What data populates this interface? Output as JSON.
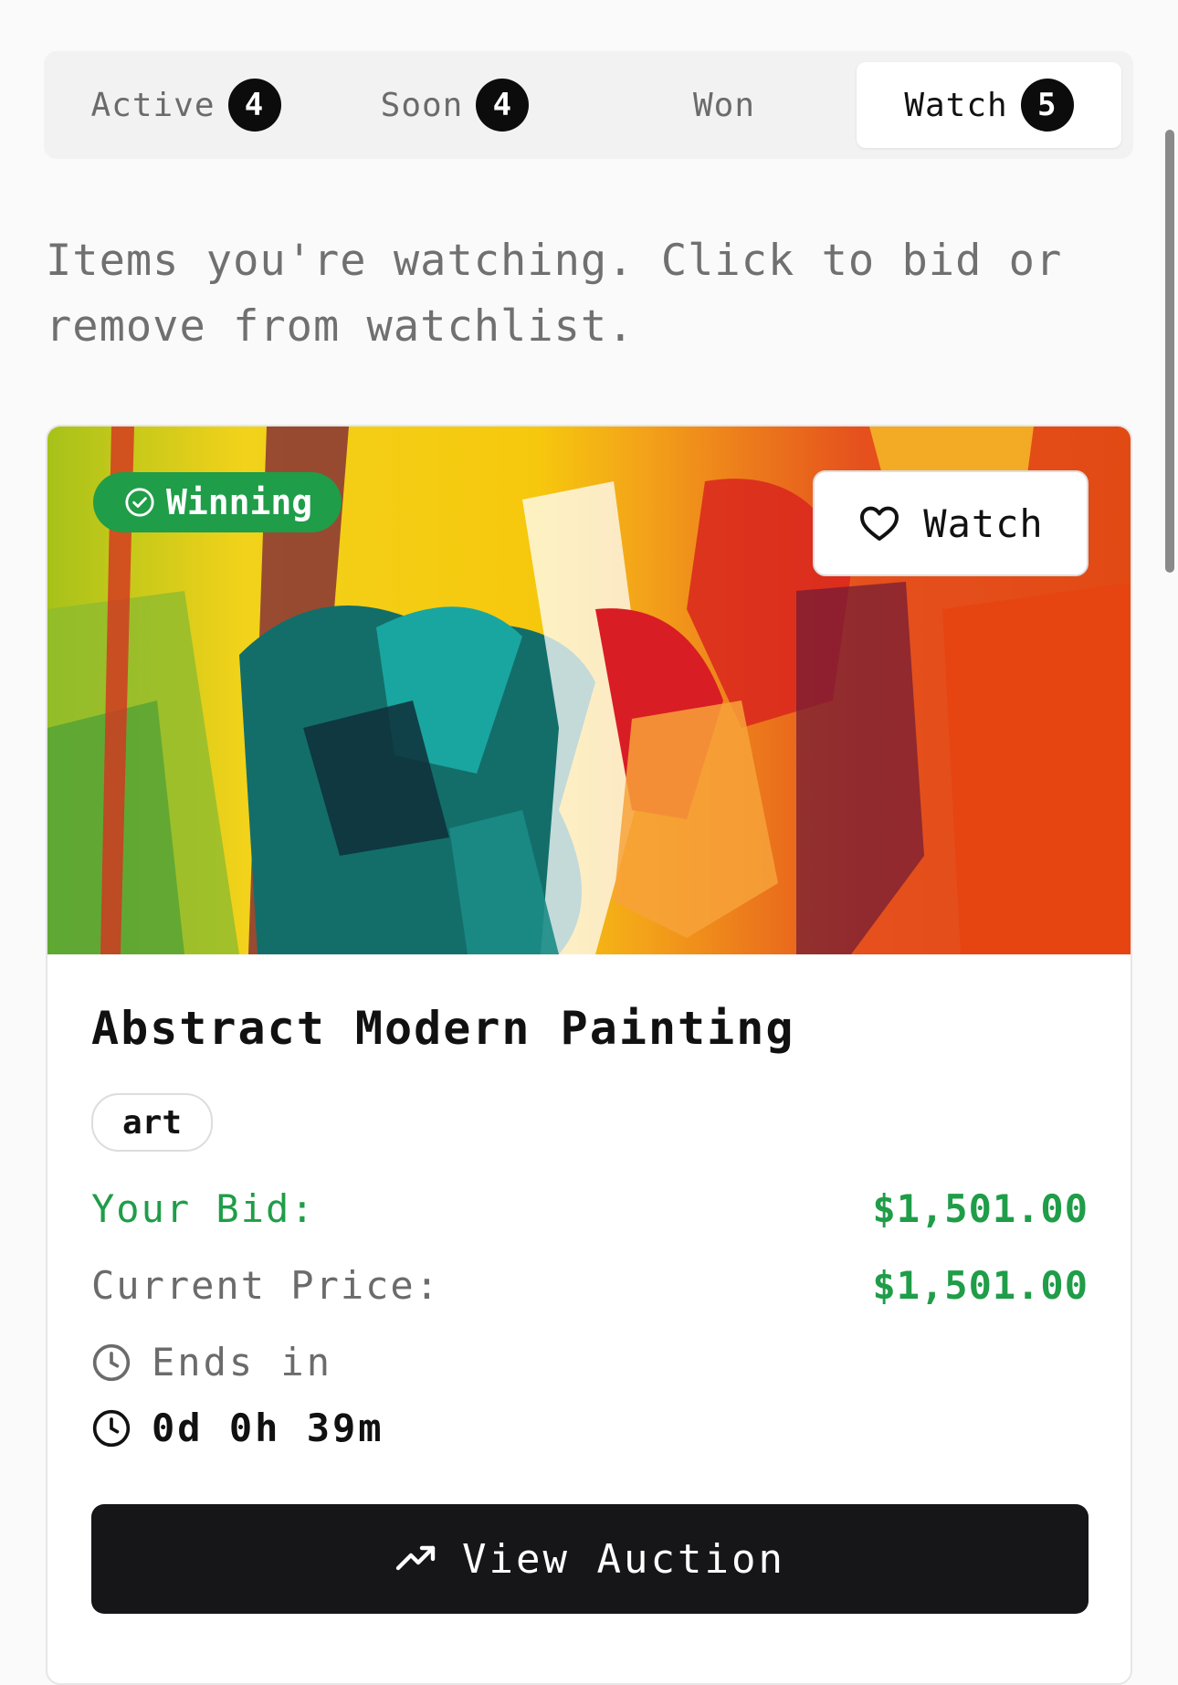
{
  "tabs": [
    {
      "label": "Active",
      "count": "4"
    },
    {
      "label": "Soon",
      "count": "4"
    },
    {
      "label": "Won"
    },
    {
      "label": "Watch",
      "count": "5",
      "selected": true
    }
  ],
  "description": "Items you're watching. Click to bid or remove from watchlist.",
  "card": {
    "status_badge": "Winning",
    "watch_label": "Watch",
    "title": "Abstract Modern Painting",
    "tag": "art",
    "your_bid_label": "Your Bid:",
    "your_bid_value": "$1,501.00",
    "current_price_label": "Current Price:",
    "current_price_value": "$1,501.00",
    "ends_label": "Ends in",
    "ends_time": "0d 0h 39m",
    "view_label": "View Auction"
  },
  "colors": {
    "accent_green": "#1f9d48",
    "button_dark": "#161618",
    "badge_black": "#0c0c0c"
  },
  "icons": [
    "check-circle-icon",
    "heart-icon",
    "clock-icon",
    "trending-up-icon"
  ]
}
